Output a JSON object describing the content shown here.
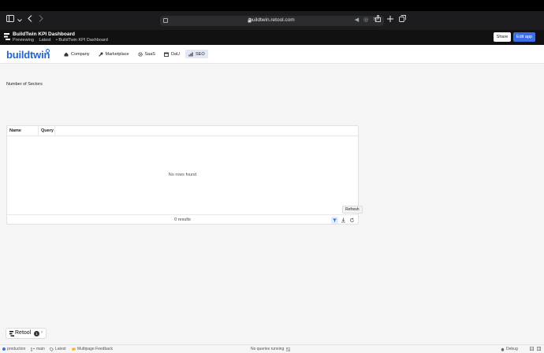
{
  "browser": {
    "url": "buildtwin.retool.com"
  },
  "preview_bar": {
    "title": "BuildTwin KPI Dashboard",
    "mode": "Previewing",
    "version": "Latest",
    "page": "• BuildTwin KPI Dashboard",
    "share_label": "Share",
    "edit_label": "Edit app"
  },
  "header": {
    "brand": "buildtwin",
    "nav": [
      {
        "label": "Company",
        "icon": "home-icon"
      },
      {
        "label": "Marketplace",
        "icon": "wrench-icon"
      },
      {
        "label": "SaaS",
        "icon": "gear-icon"
      },
      {
        "label": "DaU",
        "icon": "calendar-icon"
      },
      {
        "label": "SEO",
        "icon": "bar-chart-icon",
        "active": true
      }
    ]
  },
  "main": {
    "sectors_label": "Number of Sectors",
    "table": {
      "columns": [
        "Name",
        "Query"
      ],
      "empty_message": "No rows found",
      "results": "0 results",
      "tooltip": "Refresh"
    }
  },
  "retool_badge": {
    "label": "Retool",
    "count": "1"
  },
  "status_bar": {
    "environment": "production",
    "branch": "main",
    "version": "Latest",
    "feedback": "Multipage Feedback",
    "queries": "No queries running",
    "debug": "Debug"
  },
  "colors": {
    "brand": "#1f64d6",
    "edit_button": "#3d6ee8",
    "active_nav": "#e3e8f6",
    "environment_dot": "#3d6ee8"
  }
}
